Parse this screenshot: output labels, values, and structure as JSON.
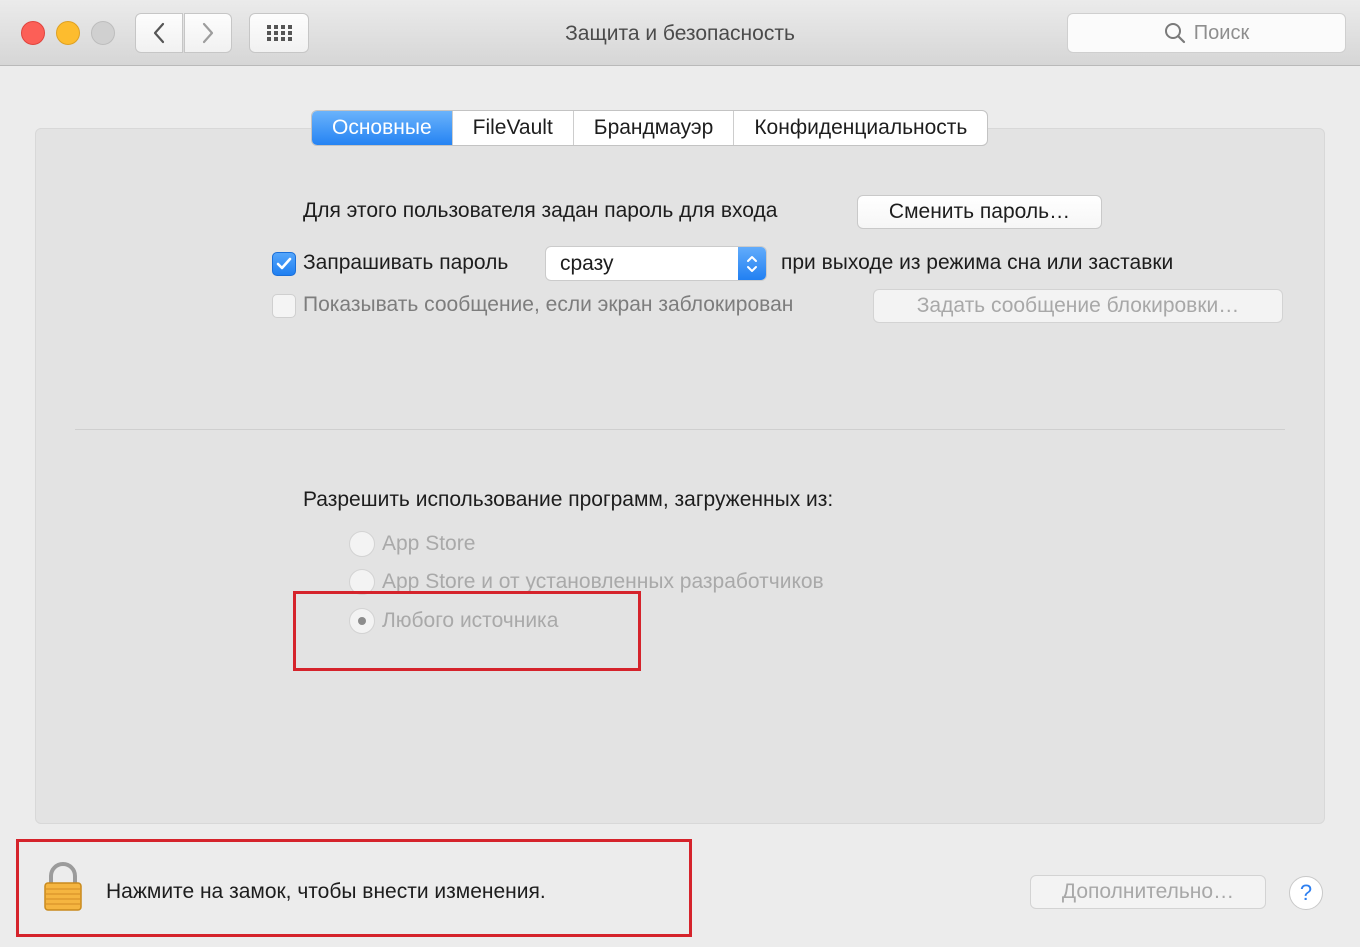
{
  "window": {
    "title": "Защита и безопасность",
    "search_placeholder": "Поиск"
  },
  "tabs": [
    {
      "label": "Основные",
      "active": true
    },
    {
      "label": "FileVault",
      "active": false
    },
    {
      "label": "Брандмауэр",
      "active": false
    },
    {
      "label": "Конфиденциальность",
      "active": false
    }
  ],
  "general": {
    "password_set_text": "Для этого пользователя задан пароль для входа",
    "change_password_label": "Сменить пароль…",
    "require_password_label": "Запрашивать пароль",
    "require_password_checked": true,
    "require_password_delay": "сразу",
    "require_password_suffix": "при выходе из режима сна или заставки",
    "show_message_label": "Показывать сообщение, если экран заблокирован",
    "show_message_checked": false,
    "set_lock_message_label": "Задать сообщение блокировки…"
  },
  "allow_apps": {
    "heading": "Разрешить использование программ, загруженных из:",
    "options": [
      {
        "label": "App Store",
        "selected": false
      },
      {
        "label": "App Store и от установленных разработчиков",
        "selected": false
      },
      {
        "label": "Любого источника",
        "selected": true
      }
    ]
  },
  "footer": {
    "lock_text": "Нажмите на замок, чтобы внести изменения.",
    "advanced_label": "Дополнительно…",
    "help_label": "?"
  },
  "colors": {
    "accent": "#2583f3",
    "highlight_box": "#d5232b"
  }
}
